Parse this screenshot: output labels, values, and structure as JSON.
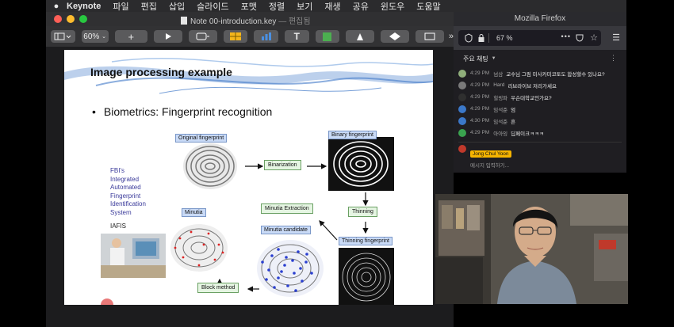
{
  "menubar": {
    "app": "Keynote",
    "items": [
      "파일",
      "편집",
      "삽입",
      "슬라이드",
      "포맷",
      "정렬",
      "보기",
      "재생",
      "공유",
      "윈도우",
      "도움말"
    ]
  },
  "keynote": {
    "doc_name": "Note 00-introduction.key",
    "doc_status": "— 편집됨",
    "zoom": "60%",
    "slide": {
      "title": "Image processing example",
      "bullet": "Biometrics: Fingerprint recognition",
      "figure": {
        "labels": {
          "original": "Original fingerprint",
          "binary": "Binary  fingerprint",
          "minutia": "Minutia",
          "minutia_candidate": "Minutia candidate",
          "thinning_fp": "Thinning fingerprint"
        },
        "process": {
          "binarization": "Binarization",
          "thinning": "Thinning",
          "minutia_extraction": "Minutia Extraction",
          "block_method": "Block method"
        },
        "fbi_lines": [
          "FBI's",
          "Integrated",
          "Automated",
          "Fingerprint",
          "Identification",
          "System"
        ],
        "iafis": "IAFIS"
      }
    }
  },
  "firefox": {
    "window_title": "Mozilla Firefox",
    "zoom": "67 %",
    "chat": {
      "header": "주요 채팅",
      "messages": [
        {
          "time": "4:29 PM",
          "name": "넘삼",
          "text": "교수님 그림 미사카미코토도 합성할수 있나요?",
          "avatar": "#8fae7a"
        },
        {
          "time": "4:29 PM",
          "name": "Hard",
          "text": "리브라이브 저리가세요",
          "avatar": "#7a7a7a"
        },
        {
          "time": "4:29 PM",
          "name": "힐링파",
          "text": "우슨대학교인가요?",
          "avatar": "#2f2f2f"
        },
        {
          "time": "4:29 PM",
          "name": "임석준",
          "text": "엄",
          "avatar": "#3b78c9"
        },
        {
          "time": "4:30 PM",
          "name": "임석준",
          "text": "흔",
          "avatar": "#3b78c9"
        },
        {
          "time": "4:29 PM",
          "name": "아아잉",
          "text": "딥페이크ㅋㅋㅋ",
          "avatar": "#3aa34f"
        }
      ],
      "me_name": "Jong Chul Yoon",
      "input_placeholder": "메시지 입력하기..."
    }
  },
  "colors": {
    "title_swoosh": "#3f78c8",
    "label_fill": "#c9daf6",
    "process_fill": "#e5f5e2",
    "fbi_text": "#3a3a9a"
  }
}
